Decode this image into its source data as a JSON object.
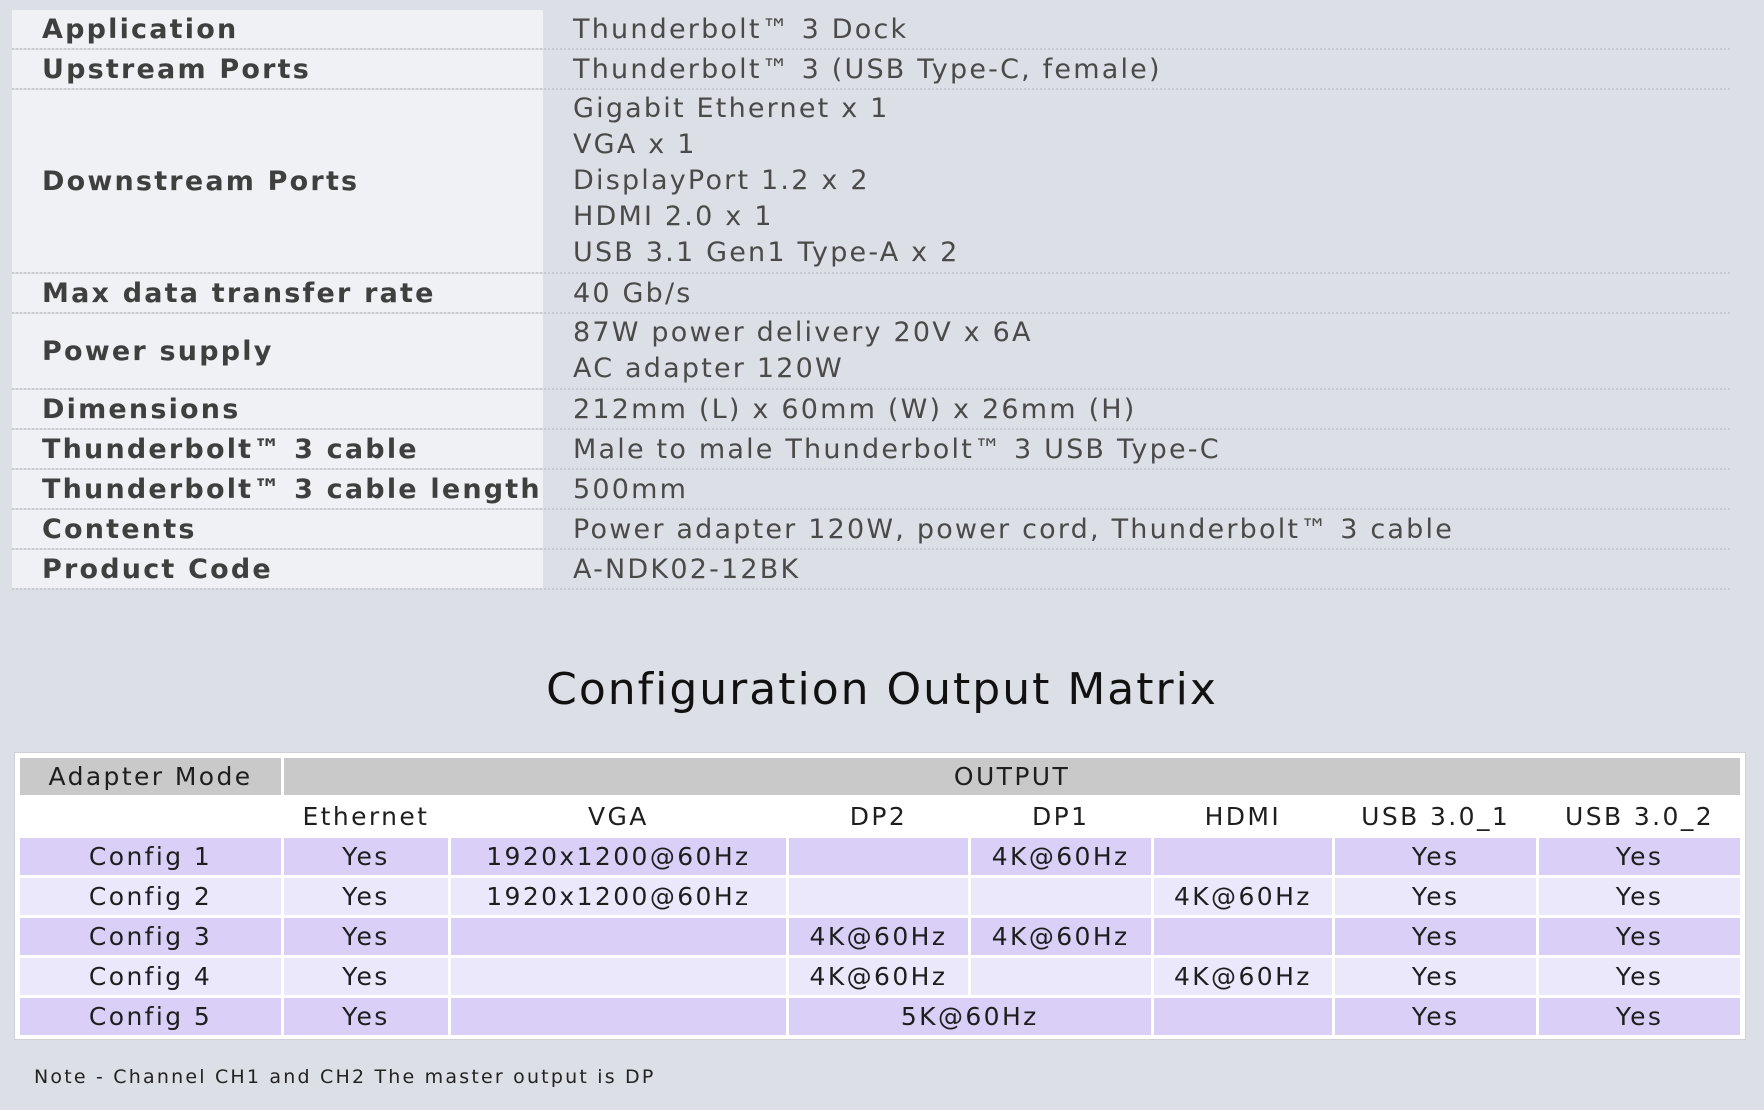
{
  "specs": [
    {
      "label": "Application",
      "values": [
        "Thunderbolt™ 3 Dock"
      ]
    },
    {
      "label": "Upstream Ports",
      "values": [
        "Thunderbolt™ 3 (USB Type-C, female)"
      ]
    },
    {
      "label": "Downstream Ports",
      "values": [
        "Gigabit Ethernet x 1",
        "VGA x 1",
        "DisplayPort 1.2 x 2",
        "HDMI 2.0 x 1",
        "USB 3.1 Gen1 Type-A x 2"
      ]
    },
    {
      "label": "Max data transfer rate",
      "values": [
        "40 Gb/s"
      ]
    },
    {
      "label": "Power supply",
      "values": [
        "87W power delivery 20V x 6A",
        "AC adapter 120W"
      ]
    },
    {
      "label": "Dimensions",
      "values": [
        "212mm (L) x 60mm (W) x 26mm (H)"
      ]
    },
    {
      "label": "Thunderbolt™ 3 cable",
      "values": [
        "Male to male Thunderbolt™ 3 USB Type-C"
      ]
    },
    {
      "label": "Thunderbolt™ 3 cable length",
      "values": [
        "500mm"
      ]
    },
    {
      "label": "Contents",
      "values": [
        "Power adapter 120W, power cord, Thunderbolt™ 3 cable"
      ]
    },
    {
      "label": "Product Code",
      "values": [
        "A-NDK02-12BK"
      ]
    }
  ],
  "matrix": {
    "title": "Configuration Output Matrix",
    "header_mode": "Adapter Mode",
    "header_output": "OUTPUT",
    "columns": [
      "",
      "Ethernet",
      "VGA",
      "DP2",
      "DP1",
      "HDMI",
      "USB 3.0_1",
      "USB 3.0_2"
    ],
    "rows": [
      {
        "config": "Config 1",
        "ethernet": "Yes",
        "vga": "1920x1200@60Hz",
        "dp2": "",
        "dp1": "4K@60Hz",
        "hdmi": "",
        "usb1": "Yes",
        "usb2": "Yes"
      },
      {
        "config": "Config 2",
        "ethernet": "Yes",
        "vga": "1920x1200@60Hz",
        "dp2": "",
        "dp1": "",
        "hdmi": "4K@60Hz",
        "usb1": "Yes",
        "usb2": "Yes"
      },
      {
        "config": "Config 3",
        "ethernet": "Yes",
        "vga": "",
        "dp2": "4K@60Hz",
        "dp1": "4K@60Hz",
        "hdmi": "",
        "usb1": "Yes",
        "usb2": "Yes"
      },
      {
        "config": "Config 4",
        "ethernet": "Yes",
        "vga": "",
        "dp2": "4K@60Hz",
        "dp1": "",
        "hdmi": "4K@60Hz",
        "usb1": "Yes",
        "usb2": "Yes"
      },
      {
        "config": "Config 5",
        "ethernet": "Yes",
        "vga": "",
        "dp_merged": "5K@60Hz",
        "hdmi": "",
        "usb1": "Yes",
        "usb2": "Yes"
      }
    ]
  },
  "note": "Note - Channel CH1 and CH2 The master output is DP"
}
